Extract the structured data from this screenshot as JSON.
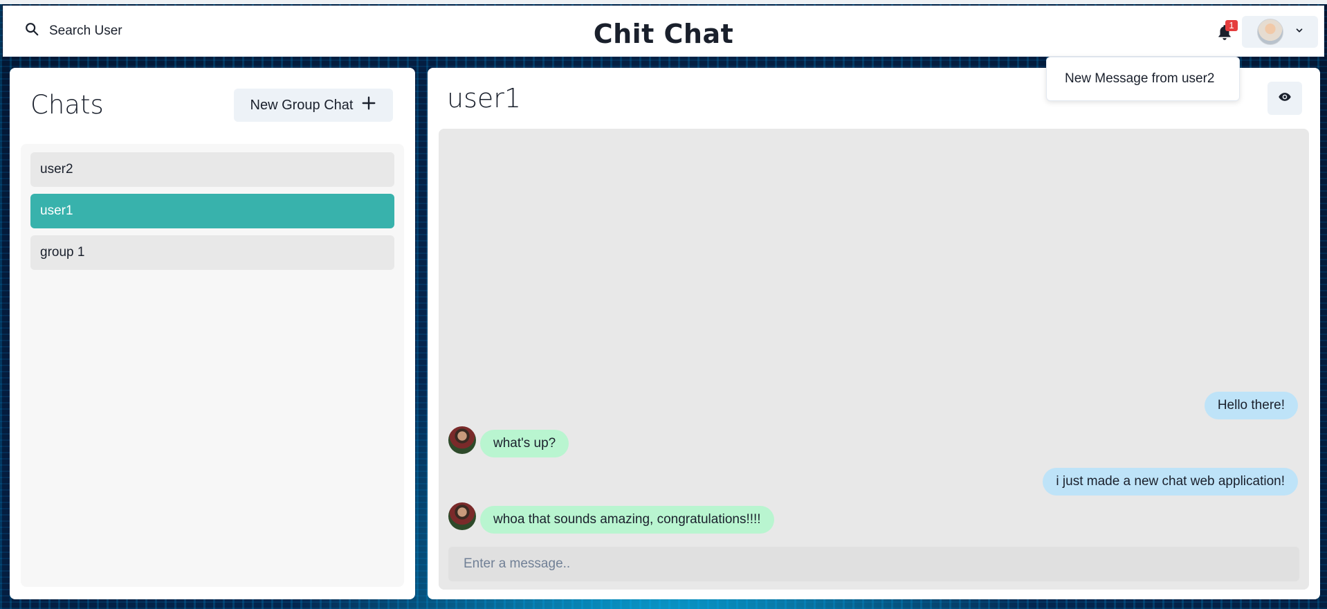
{
  "header": {
    "search_label": "Search User",
    "app_title": "Chit Chat",
    "notification_count": "1",
    "icons": {
      "search": "search-icon",
      "bell": "bell-icon",
      "chevron": "chevron-down-icon"
    }
  },
  "notifications_dropdown": {
    "items": [
      "New Message from user2"
    ]
  },
  "sidebar": {
    "title": "Chats",
    "new_group_label": "New Group Chat",
    "chats": [
      {
        "label": "user2",
        "active": false
      },
      {
        "label": "user1",
        "active": true
      },
      {
        "label": "group 1",
        "active": false
      }
    ]
  },
  "conversation": {
    "title": "user1",
    "messages": [
      {
        "from": "me",
        "text": "Hello there!"
      },
      {
        "from": "them",
        "text": "what's up?"
      },
      {
        "from": "me",
        "text": "i just made a new chat web application!"
      },
      {
        "from": "them",
        "text": "whoa that sounds amazing, congratulations!!!!"
      }
    ],
    "input_placeholder": "Enter a message.."
  },
  "colors": {
    "accent": "#38b2ac",
    "my_bubble": "#bee3f8",
    "their_bubble": "#b9f5d0",
    "badge": "#e53e3e"
  }
}
